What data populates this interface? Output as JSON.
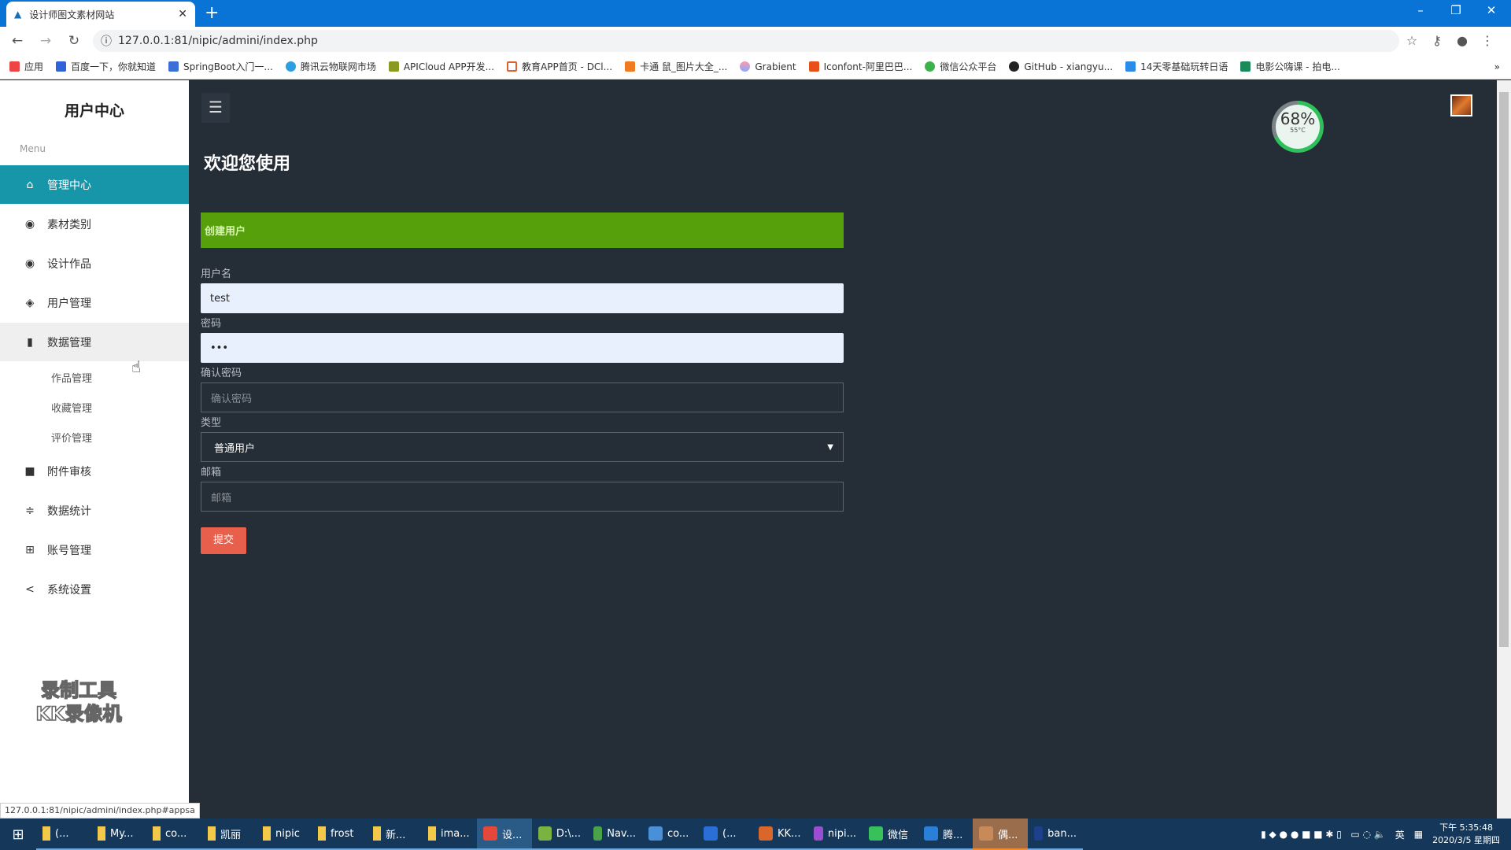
{
  "browser": {
    "tab_title": "设计师图文素材网站",
    "url": "127.0.0.1:81/nipic/admini/index.php",
    "bookmarks": [
      "应用",
      "百度一下，你就知道",
      "SpringBoot入门一...",
      "腾讯云物联网市场",
      "APICloud APP开发...",
      "教育APP首页 - DCl...",
      "卡通 鼠_图片大全_...",
      "Grabient",
      "Iconfont-阿里巴巴...",
      "微信公众平台",
      "GitHub - xiangyu...",
      "14天零基础玩转日语",
      "电影公嗨课 - 拍电..."
    ],
    "status_url": "127.0.0.1:81/nipic/admini/index.php#appsa"
  },
  "sidebar": {
    "title": "用户中心",
    "menu_label": "Menu",
    "items": [
      {
        "label": "管理中心",
        "icon": "home-icon"
      },
      {
        "label": "素材类别",
        "icon": "disc-icon"
      },
      {
        "label": "设计作品",
        "icon": "disc-icon"
      },
      {
        "label": "用户管理",
        "icon": "layers-icon"
      },
      {
        "label": "数据管理",
        "icon": "book-icon"
      },
      {
        "label": "附件审核",
        "icon": "video-icon"
      },
      {
        "label": "数据统计",
        "icon": "sliders-icon"
      },
      {
        "label": "账号管理",
        "icon": "plus-square-icon"
      },
      {
        "label": "系统设置",
        "icon": "share-icon"
      }
    ],
    "subitems": [
      "作品管理",
      "收藏管理",
      "评价管理"
    ],
    "watermark": "录制工具 KK录像机"
  },
  "main": {
    "welcome": "欢迎您使用",
    "panel_title": "创建用户",
    "form": {
      "username_label": "用户名",
      "username_value": "test",
      "password_label": "密码",
      "password_value": "•••",
      "confirm_label": "确认密码",
      "confirm_placeholder": "确认密码",
      "type_label": "类型",
      "type_value": "普通用户",
      "email_label": "邮箱",
      "email_placeholder": "邮箱",
      "submit": "提交"
    }
  },
  "widget": {
    "percent": "68%",
    "temp": "55°C",
    "value": 68
  },
  "taskbar": {
    "items": [
      "(...",
      "My...",
      "co...",
      "凯丽",
      "nipic",
      "frost",
      "新...",
      "ima...",
      "设...",
      "D:\\...",
      "Nav...",
      "co...",
      "(...",
      "KK...",
      "nipi...",
      "微信",
      "腾...",
      "偶...",
      "ban..."
    ],
    "ime": "英",
    "time": "下午 5:35:48",
    "date": "2020/3/5 星期四"
  },
  "colors": {
    "accent": "#1795a9",
    "panel": "#56a00c",
    "submit": "#e8604c",
    "bg": "#252d37"
  }
}
